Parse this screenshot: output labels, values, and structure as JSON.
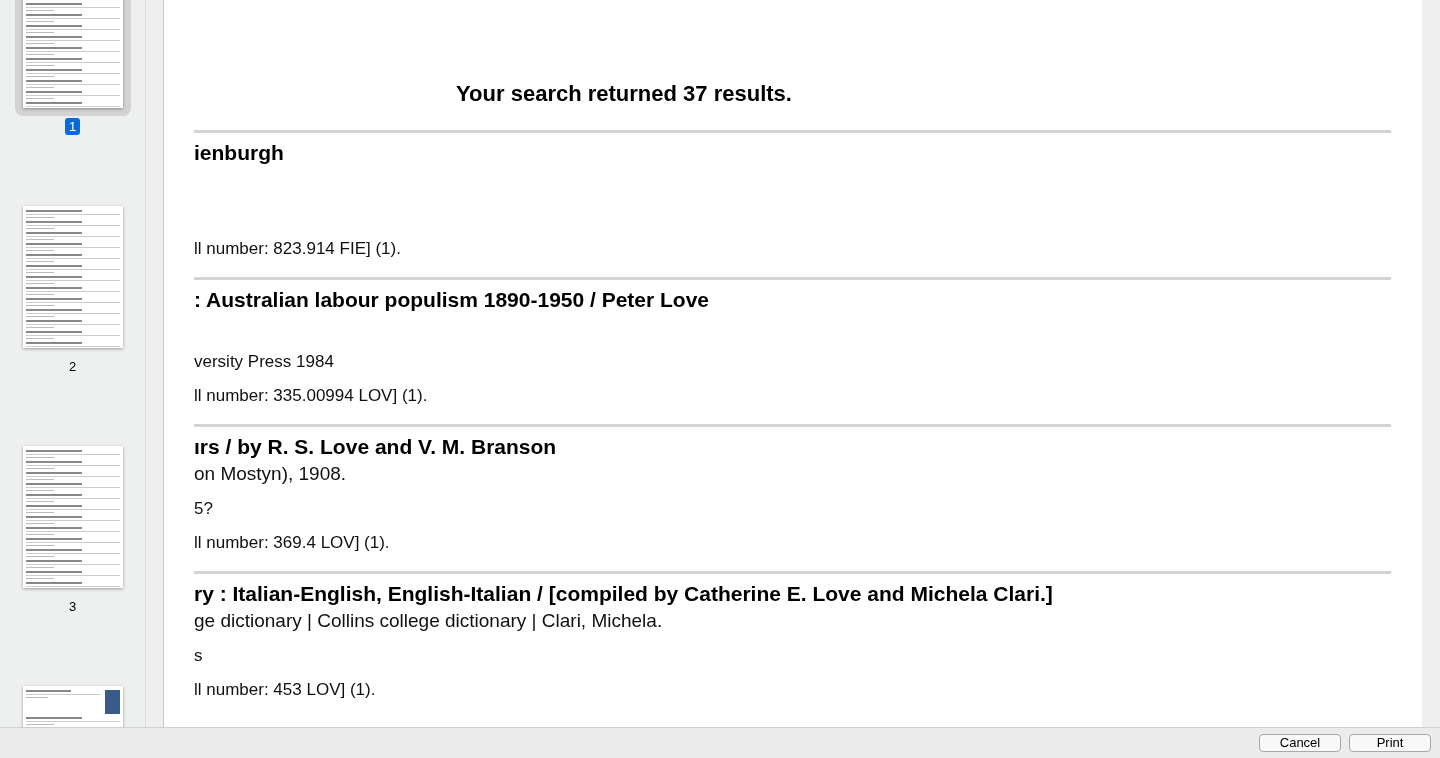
{
  "sidebar": {
    "pages": [
      {
        "label": "1",
        "selected": true,
        "images": false
      },
      {
        "label": "2",
        "selected": false,
        "images": false
      },
      {
        "label": "3",
        "selected": false,
        "images": false
      },
      {
        "selected": false,
        "images": true
      }
    ]
  },
  "preview": {
    "heading": "Your search returned 37 results.",
    "records": [
      {
        "title": "ienburgh",
        "call_number": "ll number: 823.914 FIE] (1)."
      },
      {
        "title": ": Australian labour populism 1890-1950 / Peter Love",
        "lines": [
          {
            "kind": "note",
            "text": "versity Press 1984"
          }
        ],
        "call_number": "ll number: 335.00994 LOV] (1)."
      },
      {
        "title": "ırs / by R. S. Love and V. M. Branson",
        "lines": [
          {
            "kind": "subtitle",
            "text": "on Mostyn), 1908."
          },
          {
            "kind": "note",
            "text": "5?"
          }
        ],
        "call_number": "ll number: 369.4 LOV] (1)."
      },
      {
        "title": "ry : Italian-English, English-Italian / [compiled by Catherine E. Love and Michela Clari.]",
        "lines": [
          {
            "kind": "subtitle",
            "text": "ge dictionary | Collins college dictionary | Clari, Michela."
          },
          {
            "kind": "note",
            "text": "s"
          }
        ],
        "call_number": "ll number: 453 LOV] (1)."
      }
    ]
  },
  "buttons": [
    "Cancel",
    "Print"
  ]
}
